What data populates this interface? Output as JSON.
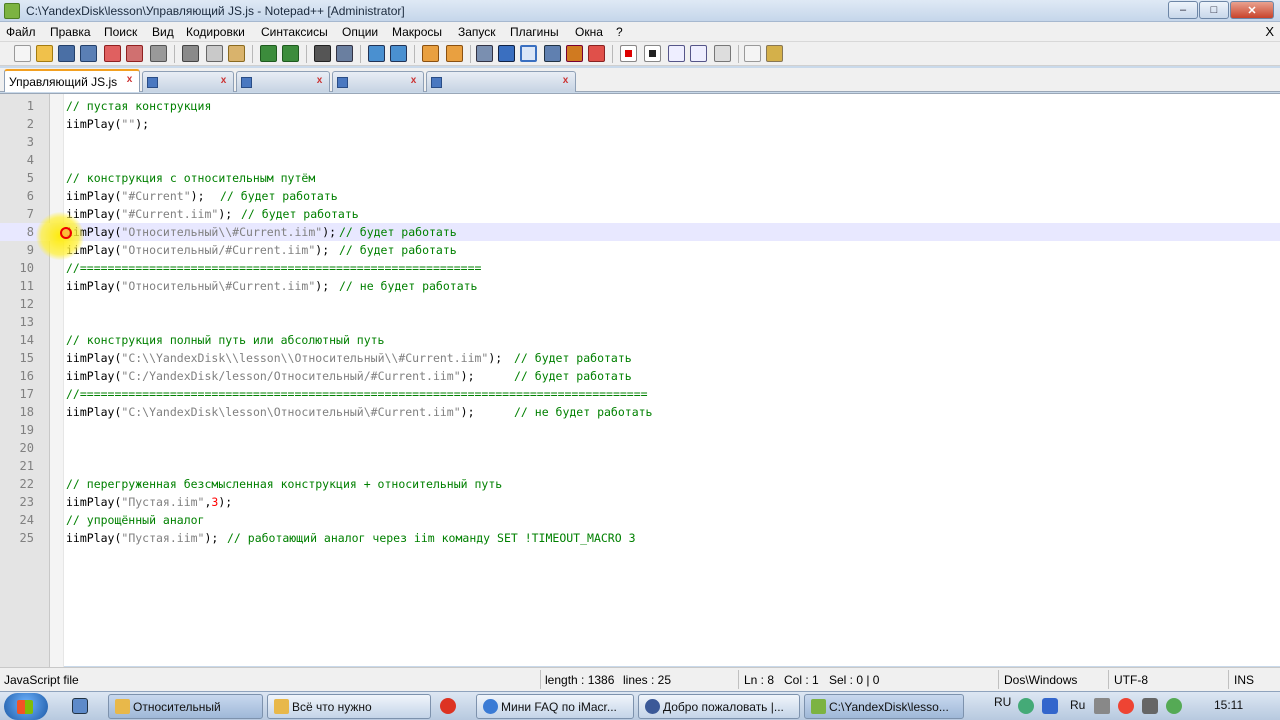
{
  "window": {
    "title": "C:\\YandexDisk\\lesson\\Управляющий JS.js - Notepad++ [Administrator]",
    "minimize": "–",
    "maximize": "□",
    "close": "✕"
  },
  "menu": [
    "Файл",
    "Правка",
    "Поиск",
    "Вид",
    "Кодировки",
    "Синтаксисы",
    "Опции",
    "Макросы",
    "Запуск",
    "Плагины",
    "Окна",
    "?"
  ],
  "menu_close": "X",
  "tabs": [
    {
      "label": "Управляющий JS.js",
      "active": true
    },
    {
      "label": "",
      "active": false
    },
    {
      "label": "",
      "active": false
    },
    {
      "label": "",
      "active": false
    },
    {
      "label": "",
      "active": false
    }
  ],
  "tab_close": "x",
  "editor": {
    "current_line": 8,
    "lines": [
      {
        "n": "1",
        "code": "",
        "comment": "// пустая конструкция"
      },
      {
        "n": "2",
        "code": "iimPlay(\"\");",
        "comment": ""
      },
      {
        "n": "3",
        "code": "",
        "comment": ""
      },
      {
        "n": "4",
        "code": "",
        "comment": ""
      },
      {
        "n": "5",
        "code": "",
        "comment": "// конструкция с относительным путём"
      },
      {
        "n": "6",
        "code": "iimPlay(\"#Current\");  ",
        "comment": "// будет работать"
      },
      {
        "n": "7",
        "code": "iimPlay(\"#Current.iim\"); ",
        "comment": "// будет работать"
      },
      {
        "n": "8",
        "code": "iimPlay(\"Относительный\\\\#Current.iim\");",
        "comment": "// будет работать"
      },
      {
        "n": "9",
        "code": "iimPlay(\"Относительный/#Current.iim\"); ",
        "comment": "// будет работать"
      },
      {
        "n": "10",
        "code": "",
        "comment": "//=========================================================="
      },
      {
        "n": "11",
        "code": "iimPlay(\"Относительный\\#Current.iim\"); ",
        "comment": "// не будет работать"
      },
      {
        "n": "12",
        "code": "",
        "comment": ""
      },
      {
        "n": "13",
        "code": "",
        "comment": ""
      },
      {
        "n": "14",
        "code": "",
        "comment": "// конструкция полный путь или абсолютный путь"
      },
      {
        "n": "15",
        "code": "iimPlay(\"C:\\\\YandexDisk\\\\lesson\\\\Относительный\\\\#Current.iim\"); ",
        "comment": "// будет работать"
      },
      {
        "n": "16",
        "code": "iimPlay(\"C:/YandexDisk/lesson/Относительный/#Current.iim\");     ",
        "comment": "// будет работать"
      },
      {
        "n": "17",
        "code": "",
        "comment": "//=================================================================================="
      },
      {
        "n": "18",
        "code": "iimPlay(\"C:\\YandexDisk\\lesson\\Относительный\\#Current.iim\");     ",
        "comment": "// не будет работать"
      },
      {
        "n": "19",
        "code": "",
        "comment": ""
      },
      {
        "n": "20",
        "code": "",
        "comment": ""
      },
      {
        "n": "21",
        "code": "",
        "comment": ""
      },
      {
        "n": "22",
        "code": "",
        "comment": "// перегруженная безсмысленная конструкция + относительный путь"
      },
      {
        "n": "23",
        "code": "iimPlay(\"Пустая.iim\",3);",
        "comment": ""
      },
      {
        "n": "24",
        "code": "",
        "comment": "// упрощённый аналог"
      },
      {
        "n": "25",
        "code": "iimPlay(\"Пустая.iim\"); ",
        "comment": "// работающий аналог через iim команду SET !TIMEOUT_MACRO 3"
      }
    ]
  },
  "status": {
    "filetype": "JavaScript file",
    "length": "length : 1386",
    "lines": "lines : 25",
    "ln": "Ln : 8",
    "col": "Col : 1",
    "sel": "Sel : 0 | 0",
    "eol": "Dos\\Windows",
    "encoding": "UTF-8",
    "mode": "INS"
  },
  "taskbar": {
    "tasks": [
      {
        "label": "Относительный",
        "active": true,
        "color": "#e8b84a"
      },
      {
        "label": "Всё что нужно",
        "active": false,
        "color": "#e8b84a"
      },
      {
        "label": "Мини FAQ по iMacr...",
        "active": false,
        "color": "#3a7bd5"
      },
      {
        "label": "Добро пожаловать |...",
        "active": false,
        "color": "#3b5998"
      },
      {
        "label": "C:\\YandexDisk\\lesso...",
        "active": true,
        "color": "#7cb342"
      }
    ],
    "lang": "RU",
    "lang2": "Ru",
    "clock": "15:11"
  },
  "colors": {
    "comment": "#008000",
    "string": "#808080",
    "number": "#ff0000",
    "current_line": "#e8e8ff"
  }
}
